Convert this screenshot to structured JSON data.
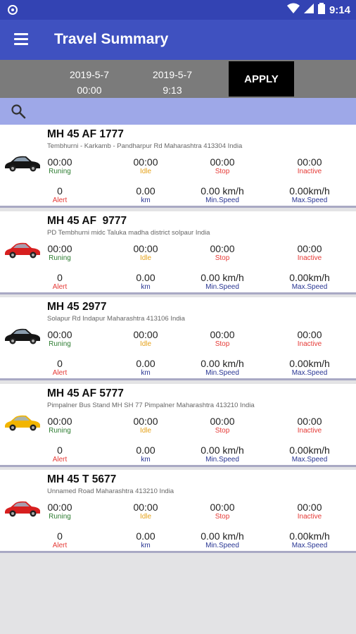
{
  "status_bar": {
    "time": "9:14"
  },
  "app_bar": {
    "title": "Travel Summary"
  },
  "date_filter": {
    "from_date": "2019-5-7",
    "from_time": "00:00",
    "to_date": "2019-5-7",
    "to_time": "9:13",
    "apply_label": "APPLY"
  },
  "stat_labels": {
    "running": "Runing",
    "idle": "Idle",
    "stop": "Stop",
    "inactive": "Inactive",
    "alert": "Alert",
    "km": "km",
    "min_speed": "Min.Speed",
    "max_speed": "Max.Speed"
  },
  "colors": {
    "primary": "#3f51c0",
    "status_bar": "#3343b3",
    "search_bar": "#9ea8e8",
    "running": "#2e7d32",
    "idle": "#e6a21a",
    "stop": "#e53935",
    "speed": "#283593"
  },
  "vehicles": [
    {
      "plate": "MH 45 AF 1777",
      "address": "Tembhurni - Karkamb - Pandharpur Rd Maharashtra 413304 India",
      "car_color": "black",
      "running": "00:00",
      "idle": "00:00",
      "stop": "00:00",
      "inactive": "00:00",
      "alert": "0",
      "km": "0.00",
      "min_speed": "0.00 km/h",
      "max_speed": "0.00km/h"
    },
    {
      "plate": "MH 45 AF  9777",
      "address": "PD Tembhurni midc Taluka madha district solpaur India",
      "car_color": "red",
      "running": "00:00",
      "idle": "00:00",
      "stop": "00:00",
      "inactive": "00:00",
      "alert": "0",
      "km": "0.00",
      "min_speed": "0.00 km/h",
      "max_speed": "0.00km/h"
    },
    {
      "plate": "MH 45 2977",
      "address": "Solapur Rd Indapur Maharashtra 413106 India",
      "car_color": "black",
      "running": "00:00",
      "idle": "00:00",
      "stop": "00:00",
      "inactive": "00:00",
      "alert": "0",
      "km": "0.00",
      "min_speed": "0.00 km/h",
      "max_speed": "0.00km/h"
    },
    {
      "plate": "MH 45 AF 5777",
      "address": "Pimpalner Bus Stand MH SH 77 Pimpalner Maharashtra 413210 India",
      "car_color": "yellow",
      "running": "00:00",
      "idle": "00:00",
      "stop": "00:00",
      "inactive": "00:00",
      "alert": "0",
      "km": "0.00",
      "min_speed": "0.00 km/h",
      "max_speed": "0.00km/h"
    },
    {
      "plate": "MH 45 T 5677",
      "address": "Unnamed Road Maharashtra 413210 India",
      "car_color": "red",
      "running": "00:00",
      "idle": "00:00",
      "stop": "00:00",
      "inactive": "00:00",
      "alert": "0",
      "km": "0.00",
      "min_speed": "0.00 km/h",
      "max_speed": "0.00km/h"
    }
  ]
}
